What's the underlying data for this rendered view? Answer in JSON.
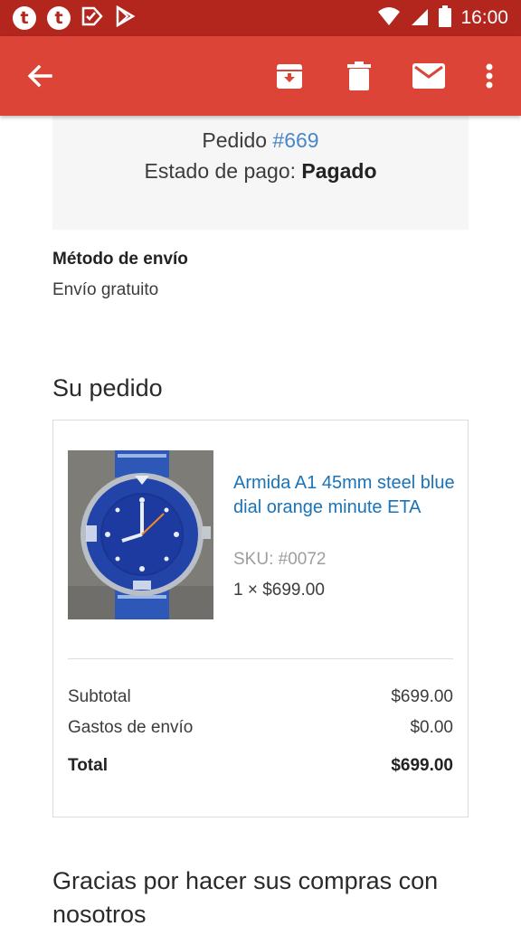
{
  "status_bar": {
    "notif_icons": [
      "t",
      "t"
    ],
    "time": "16:00"
  },
  "app_bar": {
    "icons": [
      "back-arrow-icon",
      "archive-icon",
      "delete-icon",
      "mail-icon",
      "more-vert-icon"
    ]
  },
  "order": {
    "pedido_label": "Pedido",
    "pedido_number": "#669",
    "payment_label": "Estado de pago:",
    "payment_value": "Pagado"
  },
  "shipping": {
    "title": "Método de envío",
    "value": "Envío gratuito"
  },
  "section_title": "Su pedido",
  "item": {
    "name": "Armida A1 45mm steel blue dial orange minute ETA",
    "sku": "SKU: #0072",
    "quantity_price": "1 × $699.00",
    "image": "watch-photo"
  },
  "totals": {
    "subtotal_label": "Subtotal",
    "subtotal_value": "$699.00",
    "shipping_label": "Gastos de envío",
    "shipping_value": "$0.00",
    "total_label": "Total",
    "total_value": "$699.00"
  },
  "thanks": "Gracias por hacer sus compras con nosotros",
  "colors": {
    "status_bar": "#b3261e",
    "app_bar": "#db4437",
    "link": "#1a73b8"
  }
}
